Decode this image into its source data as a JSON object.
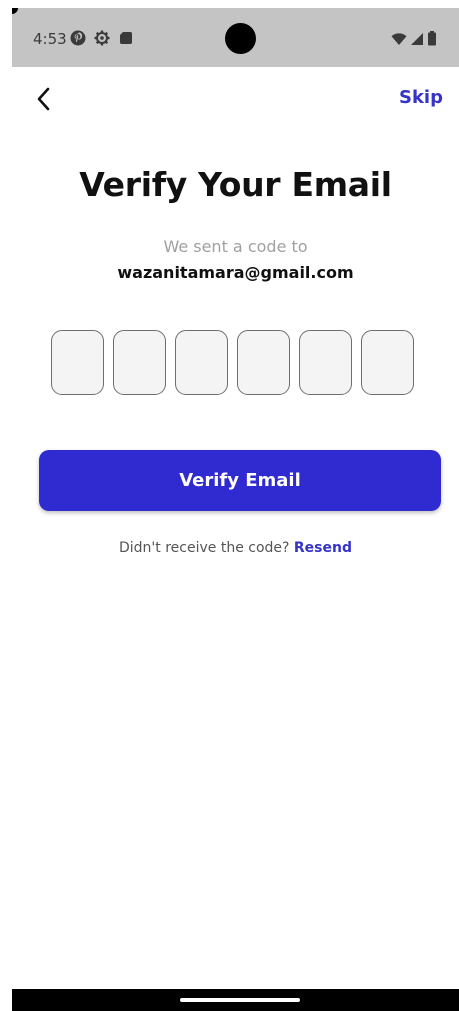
{
  "status_bar": {
    "time": "4:53",
    "left_icons": [
      "pinterest-icon",
      "settings-gear-icon",
      "sd-card-icon"
    ],
    "right_icons": [
      "wifi-icon",
      "signal-icon",
      "battery-icon"
    ]
  },
  "header": {
    "back_icon": "chevron-left-icon",
    "skip_label": "Skip"
  },
  "main": {
    "title": "Verify Your Email",
    "sent_text": "We sent a code to",
    "email": "wazanitamara@gmail.com",
    "code_length": 6,
    "verify_label": "Verify Email",
    "resend_prompt": "Didn't receive the code?",
    "resend_label": "Resend"
  },
  "colors": {
    "accent": "#302bd1",
    "link": "#3633c9",
    "status_bar_bg": "#c4c4c4"
  }
}
